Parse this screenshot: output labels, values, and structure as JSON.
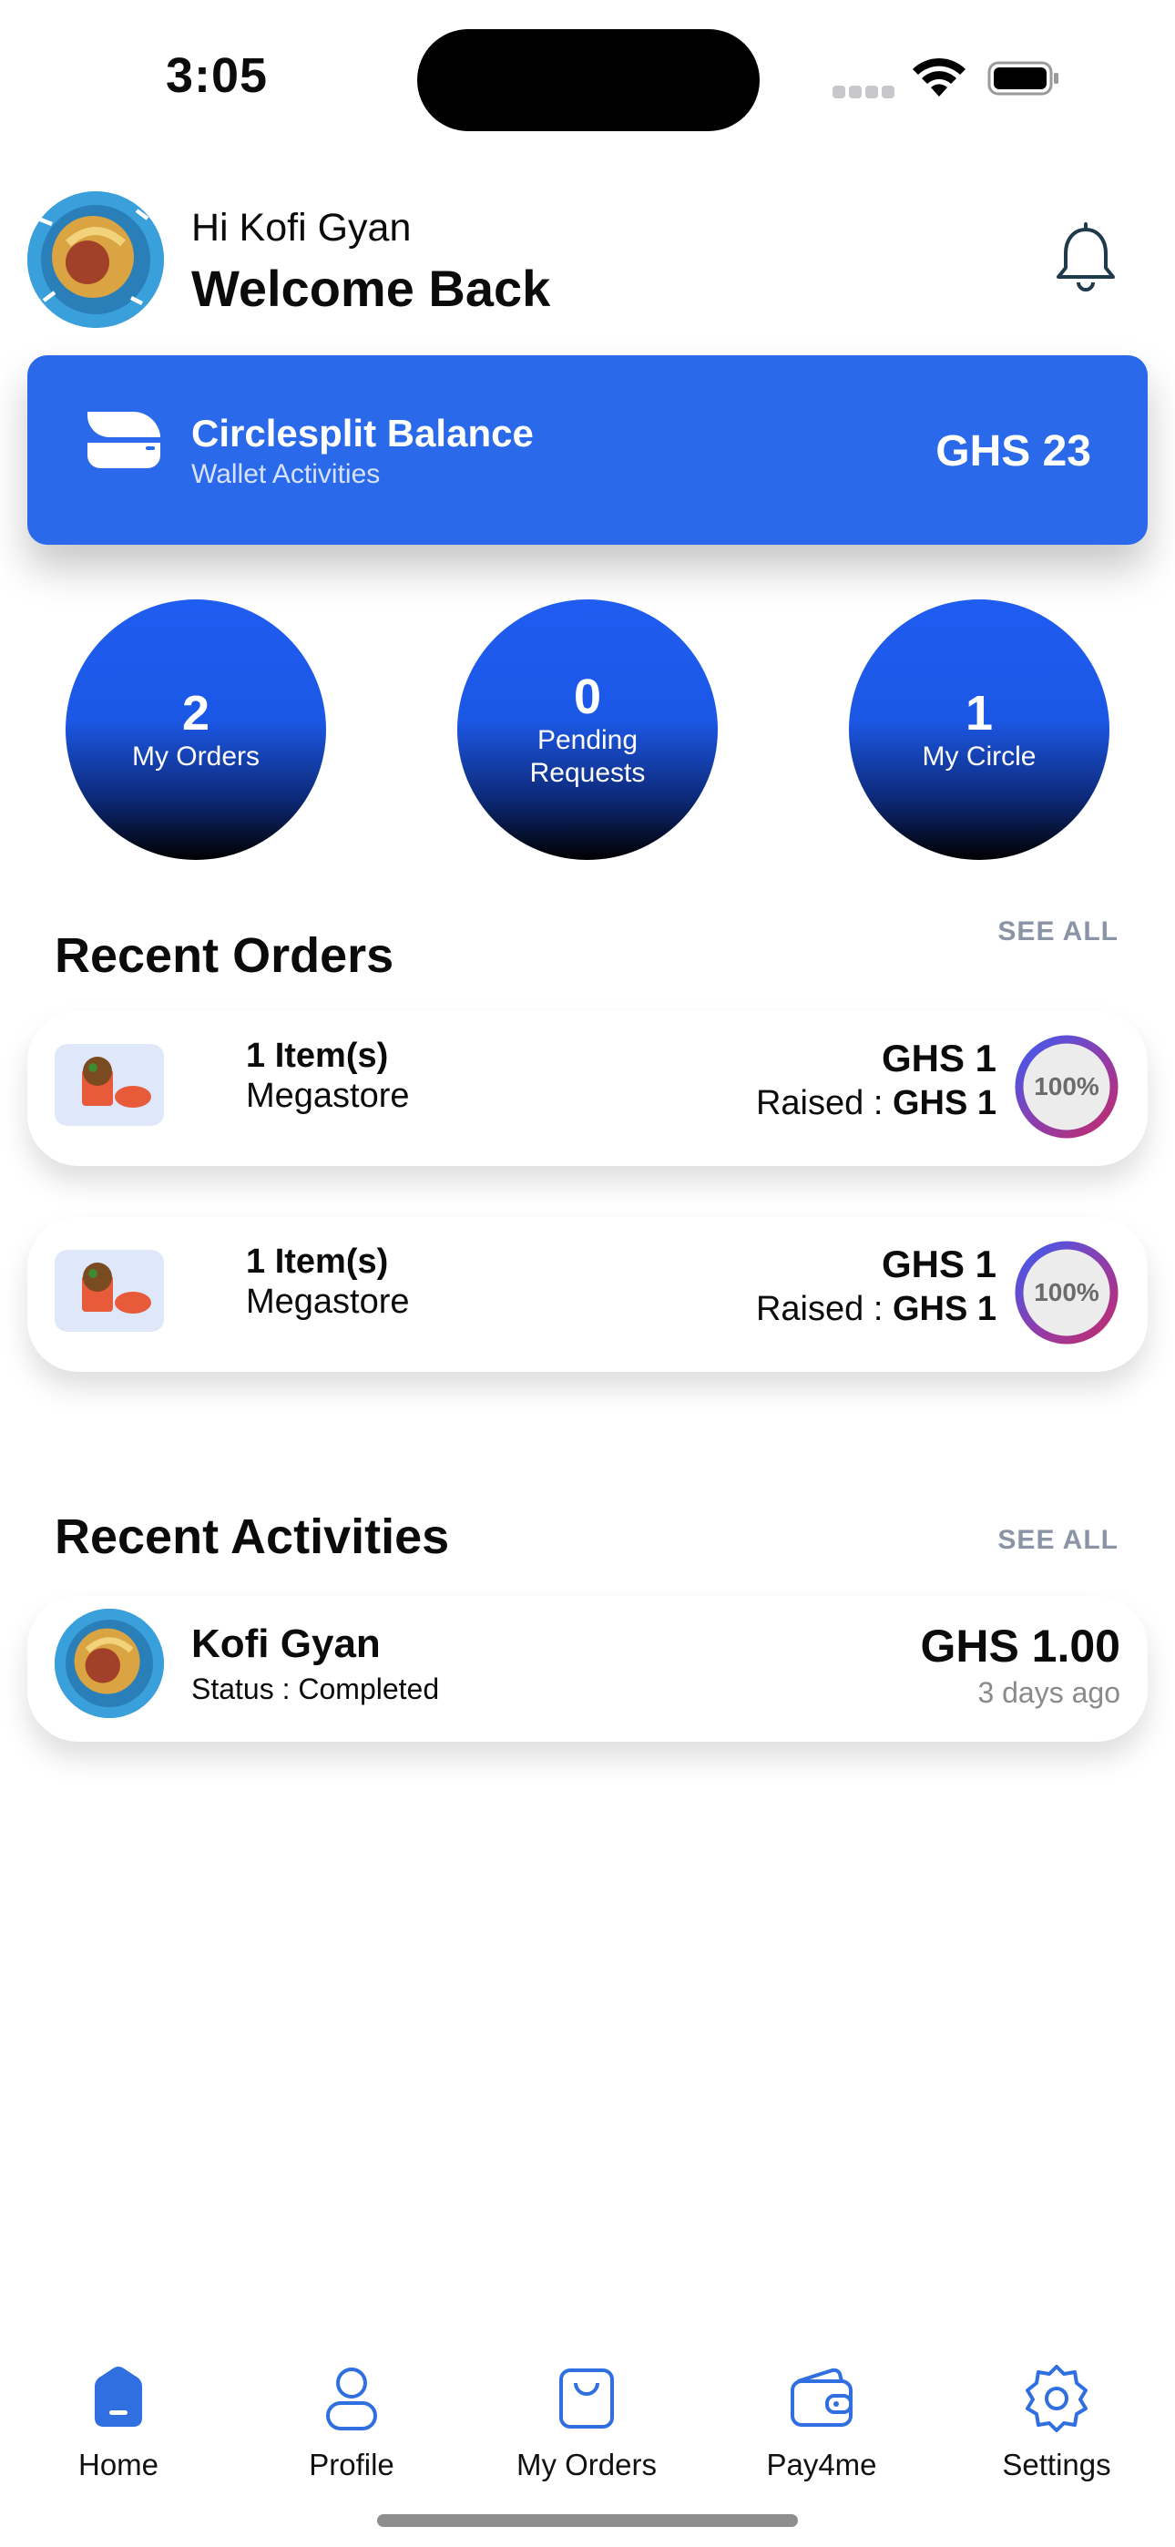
{
  "status_bar": {
    "time": "3:05"
  },
  "header": {
    "greeting": "Hi Kofi Gyan",
    "welcome": "Welcome Back"
  },
  "balance": {
    "title": "Circlesplit Balance",
    "subtitle": "Wallet Activities",
    "amount": "GHS 23"
  },
  "stats": [
    {
      "value": "2",
      "label": "My Orders"
    },
    {
      "value": "0",
      "label": "Pending Requests"
    },
    {
      "value": "1",
      "label": "My Circle"
    }
  ],
  "recent_orders": {
    "title": "Recent Orders",
    "see_all": "SEE ALL",
    "items": [
      {
        "items": "1 Item(s)",
        "store": "Megastore",
        "amount": "GHS 1",
        "raised_label": "Raised : ",
        "raised_value": "GHS 1",
        "progress_label": "100%",
        "progress": 1.0
      },
      {
        "items": "1 Item(s)",
        "store": "Megastore",
        "amount": "GHS 1",
        "raised_label": "Raised : ",
        "raised_value": "GHS 1",
        "progress_label": "100%",
        "progress": 1.0
      }
    ]
  },
  "recent_activities": {
    "title": "Recent Activities",
    "see_all": "SEE ALL",
    "items": [
      {
        "name": "Kofi Gyan",
        "status": "Status : Completed",
        "amount": "GHS 1.00",
        "time": "3 days ago"
      }
    ]
  },
  "tabs": [
    {
      "label": "Home",
      "icon": "home-icon",
      "active": true
    },
    {
      "label": "Profile",
      "icon": "profile-icon"
    },
    {
      "label": "My Orders",
      "icon": "shopping-bag-icon"
    },
    {
      "label": "Pay4me",
      "icon": "wallet-icon"
    },
    {
      "label": "Settings",
      "icon": "gear-icon"
    }
  ],
  "colors": {
    "accent": "#2a69ea",
    "tab_icon": "#2f6fe0",
    "muted": "#8a94a6"
  }
}
